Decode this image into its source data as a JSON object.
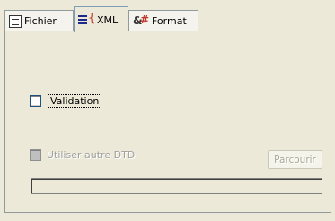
{
  "tabs": [
    {
      "label": "Fichier",
      "icon": "document-icon",
      "selected": false
    },
    {
      "label": "XML",
      "icon": "xml-icon",
      "selected": true
    },
    {
      "label": "Format",
      "icon": "format-icon",
      "selected": false
    }
  ],
  "validation": {
    "label": "Validation",
    "checked": false
  },
  "custom_dtd": {
    "label": "Utiliser autre DTD",
    "checked": false,
    "enabled": false
  },
  "browse_button": {
    "label": "Parcourir",
    "enabled": false
  },
  "dtd_path": {
    "value": "",
    "enabled": false
  }
}
